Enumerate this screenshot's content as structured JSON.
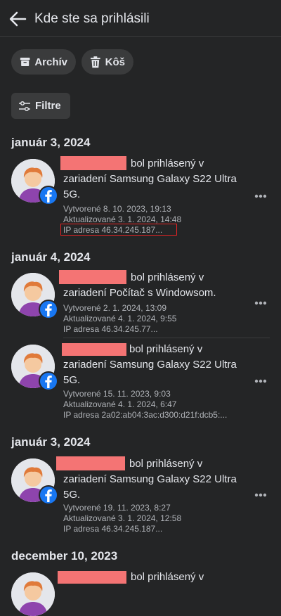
{
  "header": {
    "title": "Kde ste sa prihlásili"
  },
  "chips": {
    "archive": "Archív",
    "trash": "Kôš",
    "filter": "Filtre"
  },
  "groups": [
    {
      "date": "január 3, 2024"
    },
    {
      "date": "január 4, 2024"
    },
    {
      "date": "január 3, 2024"
    },
    {
      "date": "december 10, 2023"
    }
  ],
  "sessions": [
    {
      "line1": "bol prihlásený v",
      "line2": "zariadení Samsung Galaxy S22 Ultra",
      "line3": "5G.",
      "created": "Vytvorené 8. 10. 2023, 19:13",
      "updated": "Aktualizované 3. 1. 2024, 14:48",
      "ip": "IP adresa 46.34.245.187..."
    },
    {
      "line1": "bol prihlásený v",
      "line2": "zariadení Počítač s Windowsom.",
      "line3": "",
      "created": "Vytvorené 2. 1. 2024, 13:09",
      "updated": "Aktualizované 4. 1. 2024, 9:55",
      "ip": "IP adresa 46.34.245.77..."
    },
    {
      "line1": "bol prihlásený v",
      "line2": "zariadení Samsung Galaxy S22 Ultra",
      "line3": "5G.",
      "created": "Vytvorené 15. 11. 2023, 9:03",
      "updated": "Aktualizované 4. 1. 2024, 6:47",
      "ip": "IP adresa 2a02:ab04:3ac:d300:d21f:dcb5:..."
    },
    {
      "line1": "bol prihlásený v",
      "line2": "zariadení Samsung Galaxy S22 Ultra",
      "line3": "5G.",
      "created": "Vytvorené 19. 11. 2023, 8:27",
      "updated": "Aktualizované 3. 1. 2024, 12:58",
      "ip": "IP adresa 46.34.245.187..."
    },
    {
      "line1": "bol prihlásený v"
    }
  ],
  "colors": {
    "background": "#242526",
    "chip": "#3a3b3c",
    "facebook": "#1877f2",
    "redaction": "#f47474",
    "highlight": "#e02424"
  }
}
